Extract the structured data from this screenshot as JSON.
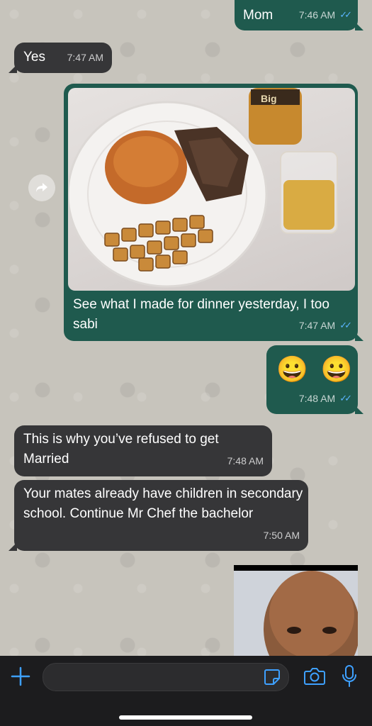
{
  "messages": {
    "m1": {
      "text": "Mom",
      "time": "7:46 AM",
      "ticks": "✓✓"
    },
    "m2": {
      "text": "Yes",
      "time": "7:47 AM"
    },
    "m3": {
      "caption": "See what I made for dinner yesterday, I too sabi",
      "time": "7:47 AM",
      "ticks": "✓✓"
    },
    "m4": {
      "emojis": "😀 😀",
      "time": "7:48 AM",
      "ticks": "✓✓"
    },
    "m5": {
      "text": "This is why you’ve refused to get Married",
      "time": "7:48 AM"
    },
    "m6": {
      "text": "Your mates already have children in secondary school. Continue Mr Chef the bachelor",
      "time": "7:50 AM"
    }
  },
  "photo_label": "Big",
  "icons": {
    "plus": "plus-icon",
    "sticker": "sticker-icon",
    "camera": "camera-icon",
    "mic": "microphone-icon",
    "forward": "forward-icon"
  },
  "colors": {
    "outgoing": "#1f5a4e",
    "incoming": "#363638",
    "accent": "#3ea0ff"
  }
}
